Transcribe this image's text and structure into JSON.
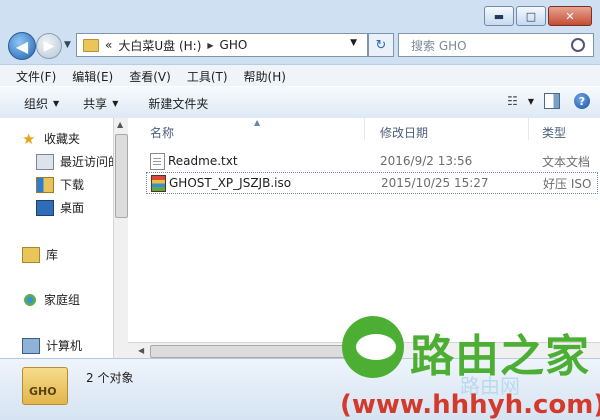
{
  "window": {
    "buttons": {
      "minimize": "▬",
      "maximize": "□",
      "close": "✕"
    }
  },
  "address": {
    "overflow": "«",
    "crumbs": [
      "大白菜U盘 (H:)",
      "GHO"
    ],
    "search_placeholder": "搜索 GHO"
  },
  "menu": [
    "文件(F)",
    "编辑(E)",
    "查看(V)",
    "工具(T)",
    "帮助(H)"
  ],
  "toolbar": {
    "organize": "组织",
    "share": "共享",
    "new_folder": "新建文件夹"
  },
  "nav": {
    "favorites": "收藏夹",
    "recent": "最近访问的",
    "downloads": "下载",
    "desktop": "桌面",
    "libraries": "库",
    "homegroup": "家庭组",
    "computer": "计算机"
  },
  "columns": {
    "name": "名称",
    "date": "修改日期",
    "type": "类型"
  },
  "files": [
    {
      "name": "Readme.txt",
      "date": "2016/9/2 13:56",
      "type": "文本文档",
      "icon": "text-file-icon"
    },
    {
      "name": "GHOST_XP_JSZJB.iso",
      "date": "2015/10/25 15:27",
      "type": "好压 ISO",
      "icon": "archive-iso-icon"
    }
  ],
  "status": {
    "count": "2 个对象",
    "folder_label": "GHO"
  },
  "watermark": {
    "brand": "路由之家",
    "brand_sub": "路由网",
    "url": "(www.hhhyh.com)"
  },
  "colors": {
    "accent": "#4caf33",
    "url_red": "#d33a2c"
  }
}
